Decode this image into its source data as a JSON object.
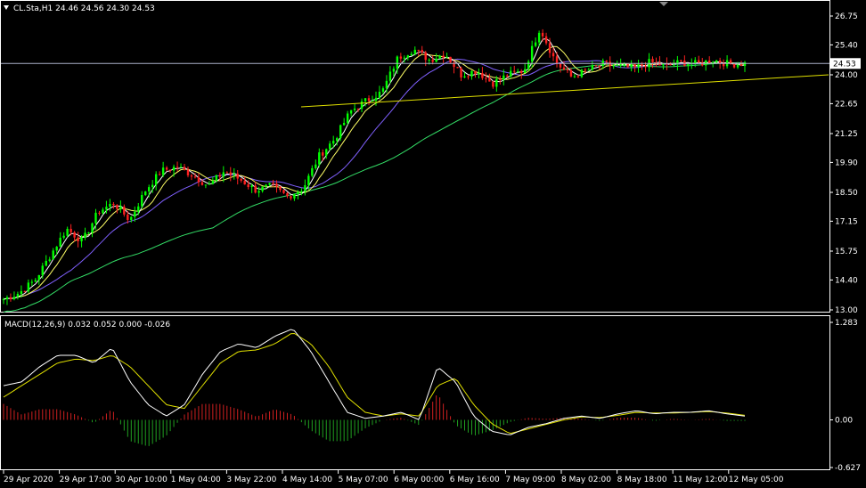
{
  "header": {
    "symbol_line": "CL.Sta,H1  24.46 24.56 24.30 24.53",
    "macd_line": "MACD(12,26,9) 0.032 0.052 0.000 -0.026"
  },
  "colors": {
    "background": "#000000",
    "frame": "#ffffff",
    "bull_candle": "#00ff00",
    "bear_candle": "#ff2020",
    "ma_fast": "#ffffff",
    "ma_medium": "#ffff66",
    "ma_slow": "#8060ff",
    "ma_long": "#33dd66",
    "trendline": "#e0e000",
    "price_line": "#aab0c8",
    "macd_line": "#ffffff",
    "signal_line": "#e0e000",
    "hist_pos": "#d02020",
    "hist_neg": "#20a020"
  },
  "chart_data": [
    {
      "type": "candlestick",
      "panel": "price",
      "ylim": [
        13.0,
        26.75
      ],
      "y_ticks": [
        "26.75",
        "25.40",
        "24.00",
        "22.65",
        "21.25",
        "19.90",
        "18.50",
        "17.15",
        "15.75",
        "14.40",
        "13.00"
      ],
      "current_price": "24.53",
      "x_ticks": [
        "29 Apr 2020",
        "29 Apr 17:00",
        "30 Apr 10:00",
        "1 May 04:00",
        "3 May 22:00",
        "4 May 14:00",
        "5 May 07:00",
        "6 May 00:00",
        "6 May 16:00",
        "7 May 09:00",
        "8 May 02:00",
        "8 May 18:00",
        "11 May 12:00",
        "12 May 05:00"
      ],
      "close_path": [
        13.5,
        13.8,
        14.4,
        15.6,
        16.8,
        16.2,
        17.6,
        18.0,
        17.2,
        18.6,
        19.5,
        19.7,
        19.3,
        18.8,
        19.5,
        19.1,
        18.6,
        18.8,
        18.3,
        18.7,
        20.2,
        21.0,
        22.3,
        22.8,
        23.2,
        24.8,
        25.2,
        24.7,
        25.0,
        24.0,
        24.2,
        23.6,
        24.0,
        24.2,
        26.2,
        24.6,
        23.9,
        24.2,
        24.5,
        24.4,
        24.3,
        24.6,
        24.4,
        24.6,
        24.5,
        24.7,
        24.5,
        24.53
      ],
      "trendline": {
        "from": 22.5,
        "to": 24.0
      }
    },
    {
      "type": "macd",
      "panel": "oscillator",
      "title": "MACD(12,26,9)",
      "ylim": [
        -0.627,
        1.283
      ],
      "y_ticks": [
        "1.283",
        "0.00",
        "-0.627"
      ],
      "macd_path": [
        0.45,
        0.5,
        0.7,
        0.85,
        0.85,
        0.75,
        0.95,
        0.5,
        0.2,
        0.05,
        0.2,
        0.6,
        0.9,
        1.0,
        0.95,
        1.1,
        1.2,
        0.9,
        0.5,
        0.1,
        0.02,
        0.05,
        0.1,
        0.0,
        0.7,
        0.5,
        0.05,
        -0.15,
        -0.2,
        -0.1,
        -0.05,
        0.02,
        0.05,
        0.02,
        0.08,
        0.12,
        0.08,
        0.1,
        0.1,
        0.12,
        0.08,
        0.05
      ],
      "signal_path": [
        0.3,
        0.45,
        0.6,
        0.75,
        0.8,
        0.78,
        0.85,
        0.7,
        0.45,
        0.2,
        0.15,
        0.45,
        0.75,
        0.9,
        0.92,
        1.0,
        1.15,
        1.0,
        0.7,
        0.3,
        0.1,
        0.05,
        0.08,
        0.05,
        0.45,
        0.55,
        0.2,
        -0.05,
        -0.18,
        -0.12,
        -0.06,
        0.0,
        0.04,
        0.03,
        0.06,
        0.1,
        0.09,
        0.09,
        0.1,
        0.11,
        0.09,
        0.06
      ]
    }
  ]
}
